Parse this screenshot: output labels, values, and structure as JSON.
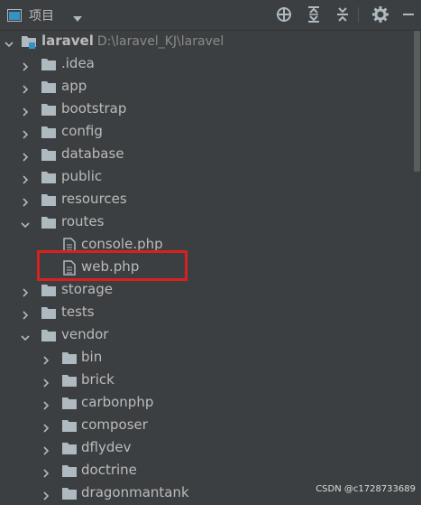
{
  "header": {
    "title": "项目",
    "icons": [
      "project-window-icon",
      "chevron-down-icon",
      "locate-icon",
      "expand-all-icon",
      "collapse-all-icon",
      "gear-icon",
      "minimize-icon"
    ]
  },
  "tree": {
    "root": {
      "name": "laravel",
      "path": "D:\\laravel_KJ\\laravel"
    },
    "items": [
      {
        "label": ".idea"
      },
      {
        "label": "app"
      },
      {
        "label": "bootstrap"
      },
      {
        "label": "config"
      },
      {
        "label": "database"
      },
      {
        "label": "public"
      },
      {
        "label": "resources"
      },
      {
        "label": "routes"
      },
      {
        "label": "console.php"
      },
      {
        "label": "web.php"
      },
      {
        "label": "storage"
      },
      {
        "label": "tests"
      },
      {
        "label": "vendor"
      },
      {
        "label": "bin"
      },
      {
        "label": "brick"
      },
      {
        "label": "carbonphp"
      },
      {
        "label": "composer"
      },
      {
        "label": "dflydev"
      },
      {
        "label": "doctrine"
      },
      {
        "label": "dragonmantank"
      }
    ]
  },
  "watermark": "CSDN @c1728733689",
  "colors": {
    "background": "#3c3f41",
    "folder": "#aeb9c0",
    "highlight": "#d8211f",
    "text": "#bbbbbb"
  }
}
